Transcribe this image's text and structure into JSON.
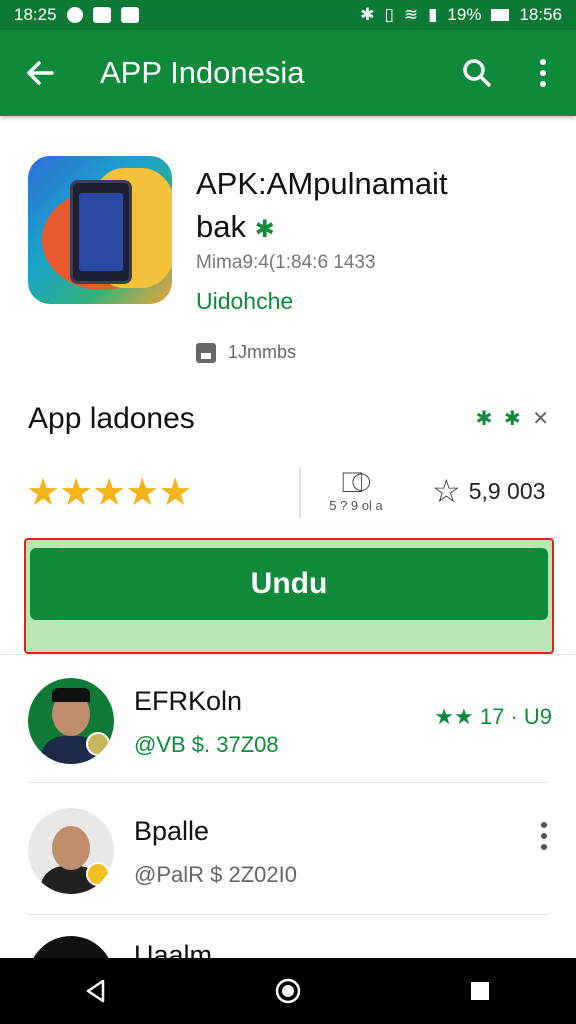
{
  "status_bar": {
    "time_left": "18:25",
    "time_right": "18:56",
    "battery": "19%"
  },
  "toolbar": {
    "title": "APP Indonesia"
  },
  "app": {
    "title_line1": "APK:AMpulnamait",
    "title_line2": "bak",
    "meta": "Mima9:4(1:84:6 1433",
    "developer": "Uidohche",
    "size": "1Jmmbs"
  },
  "section": {
    "title": "App ladones",
    "badge": "✱ ✱",
    "badge_x": "✕"
  },
  "rating": {
    "stars": "★★★★★",
    "mid_label": "5 ? 9 ol a",
    "right_value": "5,9 003"
  },
  "install": {
    "label": "Undu"
  },
  "list": {
    "items": [
      {
        "name": "EFRKoln",
        "sub": "@VB $. 37Z08",
        "rating": "★★ 17 · U9"
      },
      {
        "name": "Bpalle",
        "sub": "@PalR $ 2Z02I0"
      },
      {
        "name": "Uaalm"
      }
    ]
  },
  "colors": {
    "primary": "#0f8a3b",
    "status_bar": "#0b7a34",
    "star": "#f2b418",
    "highlight_border": "#dd2222"
  }
}
